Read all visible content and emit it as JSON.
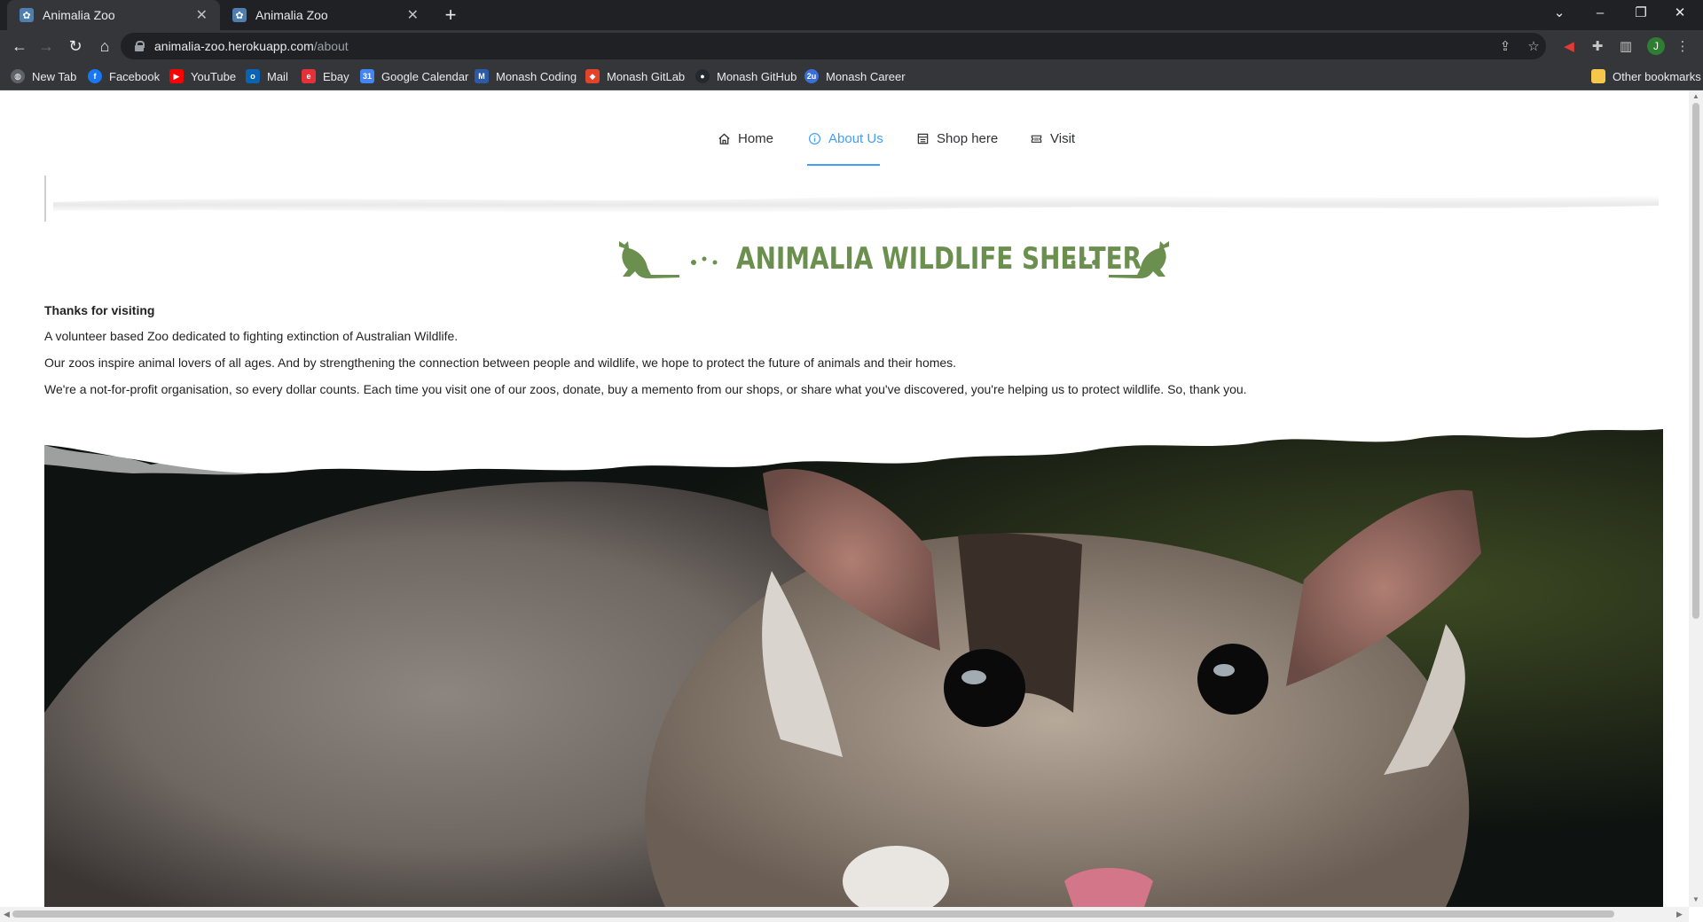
{
  "browser": {
    "tabs": [
      {
        "title": "Animalia Zoo",
        "active": true
      },
      {
        "title": "Animalia Zoo",
        "active": false
      }
    ],
    "address": {
      "host": "animalia-zoo.herokuapp.com",
      "path": "/about"
    },
    "profile_initial": "J",
    "bookmarks": [
      {
        "label": "New Tab",
        "icon": "globe-icon",
        "color": "#5f6368"
      },
      {
        "label": "Facebook",
        "icon": "facebook-icon",
        "color": "#1877f2"
      },
      {
        "label": "YouTube",
        "icon": "youtube-icon",
        "color": "#ff0000"
      },
      {
        "label": "Mail",
        "icon": "outlook-icon",
        "color": "#0a64b4"
      },
      {
        "label": "Ebay",
        "icon": "ebay-icon",
        "color": "#e53238"
      },
      {
        "label": "Google Calendar",
        "icon": "calendar-icon",
        "color": "#4285f4"
      },
      {
        "label": "Monash Coding",
        "icon": "monash-icon",
        "color": "#2b5aa8"
      },
      {
        "label": "Monash  GitLab",
        "icon": "gitlab-icon",
        "color": "#e24329"
      },
      {
        "label": "Monash GitHub",
        "icon": "github-icon",
        "color": "#24292f"
      },
      {
        "label": "Monash Career",
        "icon": "career-icon",
        "color": "#3a6fd8"
      }
    ],
    "other_bookmarks": "Other bookmarks"
  },
  "site_nav": {
    "items": [
      {
        "label": "Home",
        "icon": "home-icon",
        "active": false
      },
      {
        "label": "About Us",
        "icon": "info-icon",
        "active": true
      },
      {
        "label": "Shop here",
        "icon": "shop-icon",
        "active": false
      },
      {
        "label": "Visit",
        "icon": "ticket-icon",
        "active": false
      }
    ],
    "accent_color": "#409eff"
  },
  "logo": {
    "text": "ANIMALIA WILDLIFE SHELTER",
    "color": "#6b8f4e"
  },
  "about": {
    "heading": "Thanks for visiting",
    "paragraphs": [
      "A volunteer based Zoo dedicated to fighting extinction of Australian Wildlife.",
      "Our zoos inspire animal lovers of all ages. And by strengthening the connection between people and wildlife, we hope to protect the future of animals and their homes.",
      "We're a not-for-profit organisation, so every dollar counts. Each time you visit one of our zoos, donate, buy a memento from our shops, or share what you've discovered, you're helping us to protect wildlife. So, thank you."
    ]
  },
  "hero": {
    "subject": "sugar glider photo"
  }
}
